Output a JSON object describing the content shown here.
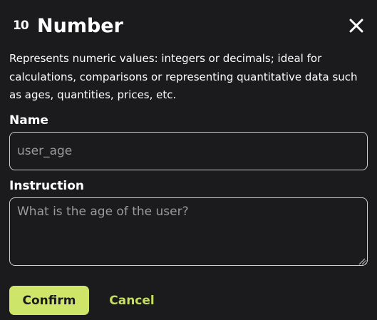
{
  "dialog": {
    "type_icon_text": "10",
    "title": "Number",
    "description": "Represents numeric values: integers or decimals; ideal for calculations, comparisons or representing quantitative data such as ages, quantities, prices, etc."
  },
  "form": {
    "name_label": "Name",
    "name_value": "",
    "name_placeholder": "user_age",
    "instruction_label": "Instruction",
    "instruction_value": "",
    "instruction_placeholder": "What is the age of the user?"
  },
  "actions": {
    "confirm_label": "Confirm",
    "cancel_label": "Cancel"
  },
  "icons": {
    "close": "close-icon",
    "type": "number-type-icon",
    "resize": "resize-grip-icon"
  },
  "colors": {
    "background": "#1b1b1d",
    "accent": "#cde66a",
    "accent_text": "#c5df5d",
    "border": "#cfcfcf",
    "placeholder": "#9a9a9a"
  }
}
